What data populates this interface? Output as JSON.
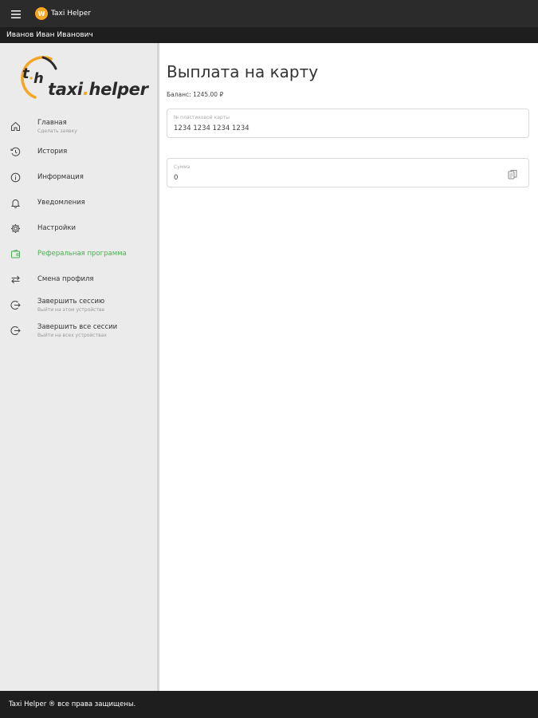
{
  "app": {
    "title": "Taxi Helper",
    "logo_letter": "W",
    "user_name": "Иванов Иван Иванович"
  },
  "brand": {
    "logo_text_part1": "taxi",
    "logo_text_dot": ".",
    "logo_text_part2": "helper",
    "logo_mark": "t h"
  },
  "sidebar": {
    "items": [
      {
        "label": "Главная",
        "sub": "Сделать заявку",
        "icon": "home-icon"
      },
      {
        "label": "История",
        "sub": "",
        "icon": "history-icon"
      },
      {
        "label": "Информация",
        "sub": "",
        "icon": "info-icon"
      },
      {
        "label": "Уведомления",
        "sub": "",
        "icon": "bell-icon"
      },
      {
        "label": "Настройки",
        "sub": "",
        "icon": "gear-icon"
      },
      {
        "label": "Реферальная программа",
        "sub": "",
        "icon": "wallet-icon",
        "active": true
      },
      {
        "label": "Смена профиля",
        "sub": "",
        "icon": "swap-icon"
      },
      {
        "label": "Завершить сессию",
        "sub": "Выйти на этом устройстве",
        "icon": "logout-icon"
      },
      {
        "label": "Завершить все сессии",
        "sub": "Выйти на всех устройствах",
        "icon": "logout-all-icon"
      }
    ]
  },
  "main": {
    "title": "Выплата на карту",
    "balance": "Баланс: 1245.00 ₽",
    "card_field": {
      "label": "№ пластиковой карты",
      "value": "1234 1234 1234 1234"
    },
    "amount_field": {
      "label": "Сумма",
      "value": "0"
    }
  },
  "footer": {
    "text": "Taxi Helper ® все права защищены."
  },
  "colors": {
    "accent": "#4caf50",
    "brand_orange": "#f5a623",
    "topbar": "#2b2b2b",
    "sidebar_bg": "#ebebeb"
  }
}
